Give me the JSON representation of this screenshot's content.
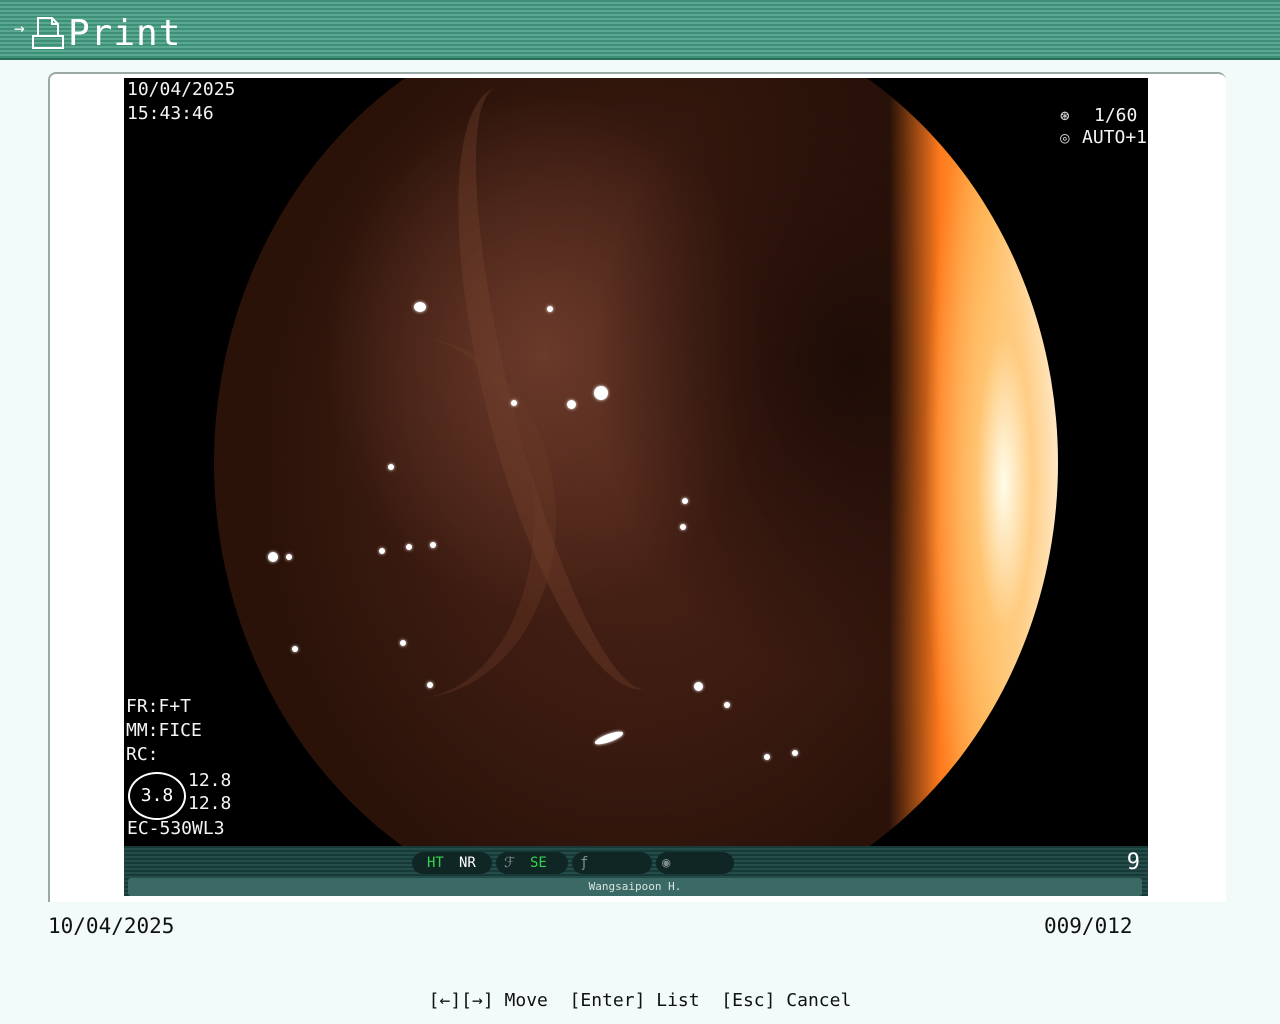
{
  "header": {
    "title": "Print",
    "icon": "print-icon",
    "arrow_glyph": "→"
  },
  "image": {
    "date": "10/04/2025",
    "time": "15:43:46",
    "shutter": "1/60",
    "iris": "AUTO+1",
    "fr": "FR:F+T",
    "mm": "MM:FICE",
    "rc": "RC:",
    "zoom": "3.8",
    "zoom_val1": "12.8",
    "zoom_val2": "12.8",
    "scope_model": "EC-530WL3",
    "status": {
      "ht": "HT",
      "nr": "NR",
      "se": "SE",
      "frame_number": "9",
      "operator": "Wangsaipoon H."
    }
  },
  "footer": {
    "date": "10/04/2025",
    "counter": "009/012",
    "hint": "[←][→] Move  [Enter] List  [Esc] Cancel"
  },
  "colors": {
    "header": "#3d8f78",
    "accent_green": "#37d44b",
    "background": "#f2fbf9"
  }
}
